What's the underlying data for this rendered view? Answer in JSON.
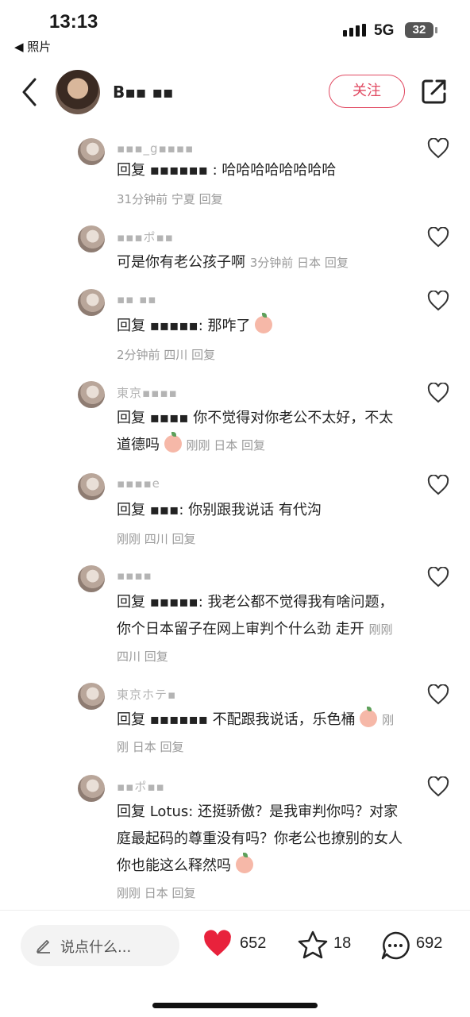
{
  "status_bar": {
    "time": "13:13",
    "back_app": "◀ 照片",
    "network": "5G",
    "battery": "32"
  },
  "header": {
    "user_name": "B▪▪ ▪▪",
    "follow_label": "关注"
  },
  "comments": [
    {
      "name": "▪▪▪_g▪▪▪▪",
      "text": "回复 ▪▪▪▪▪▪ : 哈哈哈哈哈哈哈哈",
      "meta": "31分钟前 宁夏 回复"
    },
    {
      "name": "▪▪▪ポ▪▪",
      "text": "可是你有老公孩子啊",
      "meta": "3分钟前 日本 回复"
    },
    {
      "name": "▪▪ ▪▪",
      "text": "回复 ▪▪▪▪▪: 那咋了",
      "meta": "2分钟前 四川 回复"
    },
    {
      "name": "東京▪▪▪▪",
      "text": "回复 ▪▪▪▪ 你不觉得对你老公不太好，不太道德吗",
      "meta": "刚刚 日本 回复"
    },
    {
      "name": "▪▪▪▪e",
      "text": "回复 ▪▪▪: 你别跟我说话 有代沟",
      "meta": "刚刚 四川 回复"
    },
    {
      "name": "▪▪▪▪",
      "text": "回复 ▪▪▪▪▪: 我老公都不觉得我有啥问题，你个日本留子在网上审判个什么劲 走开",
      "meta": "刚刚 四川 回复"
    },
    {
      "name": "東京ホテ▪",
      "text": "回复 ▪▪▪▪▪▪ 不配跟我说话，乐色桶",
      "meta": "刚刚 日本 回复"
    },
    {
      "name": "▪▪ポ▪▪",
      "text": "回复 Lotus: 还挺骄傲？是我审判你吗？对家庭最起码的尊重没有吗？你老公也撩别的女人你也能这么释然吗",
      "meta": "刚刚 日本 回复"
    }
  ],
  "bottom_bar": {
    "input_placeholder": "说点什么...",
    "likes": "652",
    "favorites": "18",
    "comments": "692"
  },
  "colors": {
    "accent": "#e14a62",
    "heart": "#e8223c",
    "meta": "#9a9a9a"
  },
  "icons": [
    "back-arrow-icon",
    "share-icon",
    "heart-outline-icon",
    "pencil-icon",
    "heart-filled-icon",
    "star-icon",
    "comment-bubble-icon"
  ]
}
